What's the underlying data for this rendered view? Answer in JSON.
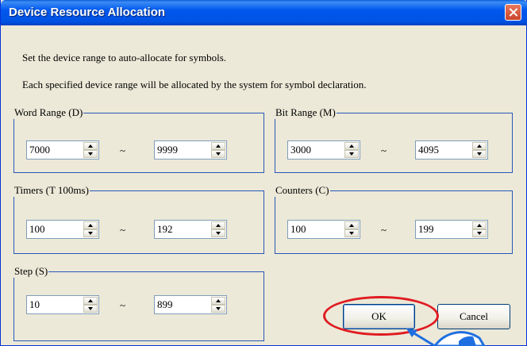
{
  "window": {
    "title": "Device Resource Allocation",
    "close_icon": "close-icon"
  },
  "intro": {
    "line1": "Set the device range to auto-allocate for symbols.",
    "line2": "Each specified device range will be allocated by the system for symbol declaration."
  },
  "groups": [
    {
      "id": "word",
      "label": "Word Range (D)",
      "start": "7000",
      "end": "9999"
    },
    {
      "id": "bit",
      "label": "Bit Range (M)",
      "start": "3000",
      "end": "4095"
    },
    {
      "id": "timers",
      "label": "Timers (T 100ms)",
      "start": "100",
      "end": "192"
    },
    {
      "id": "counters",
      "label": "Counters (C)",
      "start": "100",
      "end": "199"
    },
    {
      "id": "step",
      "label": "Step (S)",
      "start": "10",
      "end": "899"
    }
  ],
  "separator": "~",
  "buttons": {
    "ok": "OK",
    "cancel": "Cancel"
  },
  "colors": {
    "titlebar": "#0054e3",
    "dialog_bg": "#ece9d8",
    "group_border": "#2857b8",
    "highlight": "#e01b22",
    "pointer": "#1f6fe0"
  }
}
